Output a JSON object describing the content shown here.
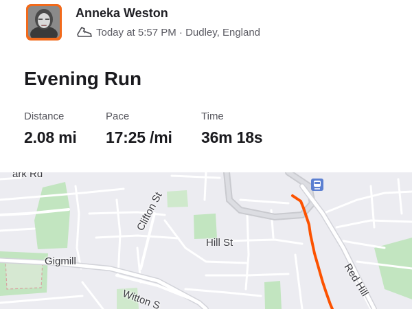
{
  "athlete": {
    "name": "Anneka Weston",
    "activity_icon": "shoe-icon",
    "meta": "Today at 5:57 PM · Dudley, England"
  },
  "activity": {
    "title": "Evening Run"
  },
  "stats": {
    "distance": {
      "label": "Distance",
      "value": "2.08 mi"
    },
    "pace": {
      "label": "Pace",
      "value": "17:25 /mi"
    },
    "time": {
      "label": "Time",
      "value": "36m 18s"
    }
  },
  "map": {
    "route_color": "#fc5200",
    "labels": {
      "park_rd": "ark Rd",
      "clifton_st": "Clifton St",
      "hill_st": "Hill St",
      "gigmill": "Gigmill",
      "witton": "Witton S",
      "red_hill": "Red Hill"
    },
    "transit_icon": "train-station-icon"
  },
  "colors": {
    "brand_orange": "#fc5200",
    "park_green": "#bfe3bf",
    "road_gray": "#cfd0d6"
  }
}
